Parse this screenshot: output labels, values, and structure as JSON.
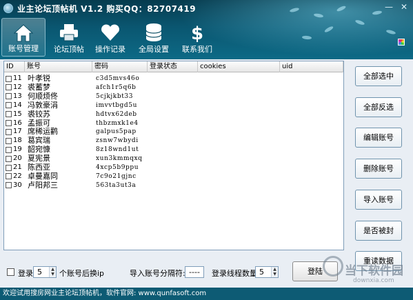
{
  "window": {
    "title": "业主论坛顶帖机 V1.2 购买QQ：82707419",
    "minimize": "—",
    "close": "✕"
  },
  "toolbar": [
    {
      "label": "账号管理",
      "icon": "home-icon",
      "active": true
    },
    {
      "label": "论坛顶帖",
      "icon": "printer-icon",
      "active": false
    },
    {
      "label": "操作记录",
      "icon": "heart-icon",
      "active": false
    },
    {
      "label": "全局设置",
      "icon": "database-icon",
      "active": false
    },
    {
      "label": "联系我们",
      "icon": "dollar-icon",
      "active": false
    }
  ],
  "table": {
    "columns": [
      "ID",
      "账号",
      "密码",
      "登录状态",
      "cookies",
      "uid"
    ],
    "rows": [
      {
        "id": "11",
        "name": "叶孝锐",
        "pwd": "c3d5mvs46o"
      },
      {
        "id": "12",
        "name": "裘蓄梦",
        "pwd": "afch1r5q6b"
      },
      {
        "id": "13",
        "name": "何顺烦佟",
        "pwd": "5cjkjkbt33"
      },
      {
        "id": "14",
        "name": "冯敦豪涓",
        "pwd": "imvvtbgd5u"
      },
      {
        "id": "15",
        "name": "裘铰苏",
        "pwd": "hdtvx62deb"
      },
      {
        "id": "16",
        "name": "孟振可",
        "pwd": "thbzmxk1e4"
      },
      {
        "id": "17",
        "name": "席稀运鹳",
        "pwd": "galpus5pap"
      },
      {
        "id": "18",
        "name": "葛宾瑞",
        "pwd": "zsnw7wbydi"
      },
      {
        "id": "19",
        "name": "韶宛慷",
        "pwd": "8z18wnd1ut"
      },
      {
        "id": "20",
        "name": "夏宪景",
        "pwd": "xun3kmmqxq"
      },
      {
        "id": "21",
        "name": "陈西亚",
        "pwd": "4xcp5b9ppu"
      },
      {
        "id": "22",
        "name": "卓曼嘉同",
        "pwd": "7c9o21gjnc"
      },
      {
        "id": "30",
        "name": "卢阳邦三",
        "pwd": "563ta3ut3a"
      }
    ]
  },
  "side_buttons": [
    "全部选中",
    "全部反选",
    "编辑账号",
    "删除账号",
    "导入账号",
    "是否被封",
    "重读数据"
  ],
  "bottom": {
    "login_check_label": "登录",
    "switch_count": "5",
    "switch_suffix": "个账号后换ip",
    "separator_label": "导入账号分隔符:",
    "separator_value": "----",
    "threads_label": "登录线程数量",
    "threads_value": "5",
    "login_button": "登陆"
  },
  "statusbar": "欢迎试用搜房网业主论坛顶帖机，软件官网: www.qunfasoft.com",
  "watermark": {
    "text": "当下软件园",
    "url": "downxia.com"
  }
}
